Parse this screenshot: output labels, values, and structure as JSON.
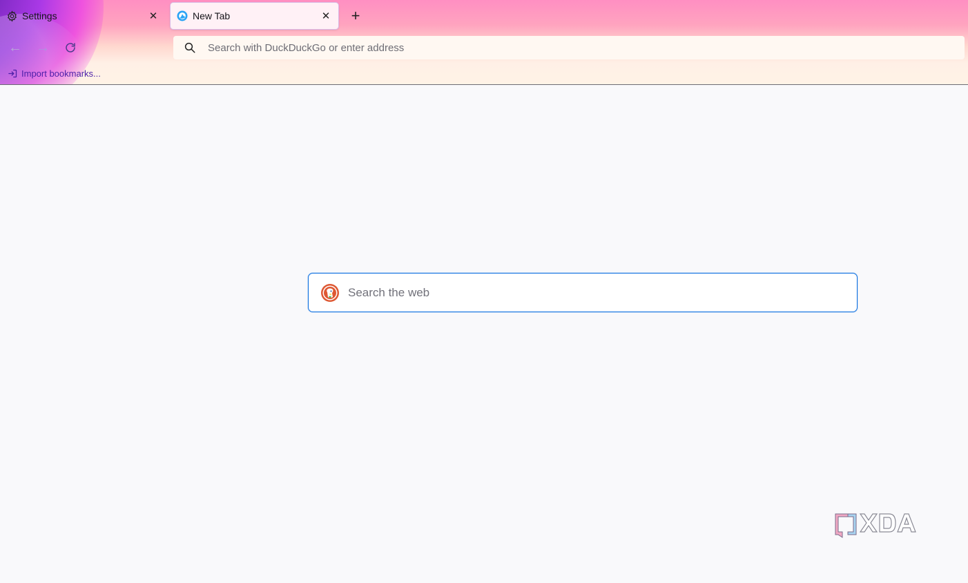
{
  "tabs": [
    {
      "label": "Settings",
      "icon": "gear-icon",
      "active": false
    },
    {
      "label": "New Tab",
      "icon": "firefox-icon",
      "active": true
    }
  ],
  "tab_close_glyph": "✕",
  "new_tab_glyph": "+",
  "nav": {
    "back_glyph": "←",
    "forward_glyph": "→",
    "reload_icon": "reload-icon"
  },
  "urlbar": {
    "placeholder": "Search with DuckDuckGo or enter address",
    "value": ""
  },
  "bookmarks": {
    "import_label": "Import bookmarks..."
  },
  "newtab": {
    "search_placeholder": "Search the web",
    "engine_icon": "duckduckgo-icon"
  },
  "watermark": {
    "text": "XDA"
  },
  "colors": {
    "accent": "#0a6ee0",
    "bookmark_text": "#4b1fa8",
    "content_bg": "#f9f9fb"
  }
}
